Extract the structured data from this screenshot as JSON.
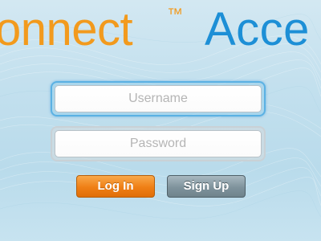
{
  "logo": {
    "left_text": "onnect",
    "trademark": "™",
    "right_text": "Acce"
  },
  "form": {
    "username": {
      "placeholder": "Username",
      "value": ""
    },
    "password": {
      "placeholder": "Password",
      "value": ""
    }
  },
  "buttons": {
    "login_label": "Log In",
    "signup_label": "Sign Up"
  },
  "colors": {
    "logo_orange": "#f29a1d",
    "logo_blue": "#1d8fd6",
    "login_button": "#ef7f15",
    "signup_button": "#7f939c",
    "focus_ring": "#5bb1e3"
  }
}
